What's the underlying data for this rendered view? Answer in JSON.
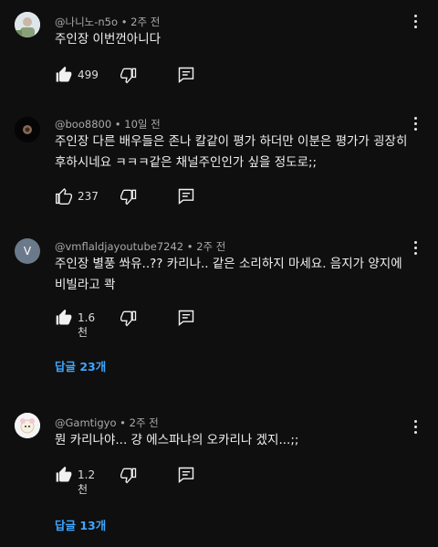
{
  "comments": [
    {
      "handle": "@나니노-n5o",
      "time": "2주 전",
      "lines": [
        "주인장 이번껀아니다"
      ],
      "likes": "499",
      "like_filled": true
    },
    {
      "handle": "@boo8800",
      "time": "10일 전",
      "lines": [
        "주인장 다른 배우들은 존나 칼같이 평가 하더만 이분은 평가가 굉장히",
        "후하시네요 ㅋㅋㅋ같은 채널주인인가 싶을 정도로;;"
      ],
      "likes": "237",
      "like_filled": false
    },
    {
      "handle": "@vmflaldjayoutube7242",
      "time": "2주 전",
      "avatar_letter": "V",
      "lines": [
        "주인장 별풍 쏴유..?? 카리나.. 같은 소리하지 마세요. 음지가 양지에",
        "비빌라고 콱"
      ],
      "likes": "1.6천",
      "like_filled": true,
      "replies": "답글 23개"
    },
    {
      "handle": "@Gamtigyo",
      "time": "2주 전",
      "lines": [
        "뭔 카리나야... 걍 에스파냐의 오카리나 겠지...;;"
      ],
      "likes": "1.2천",
      "like_filled": true,
      "replies": "답글 13개"
    }
  ],
  "colors": {
    "background": "#0f0f0f",
    "text": "#f1f1f1",
    "meta": "#aaaaaa",
    "link": "#3ea6ff"
  }
}
